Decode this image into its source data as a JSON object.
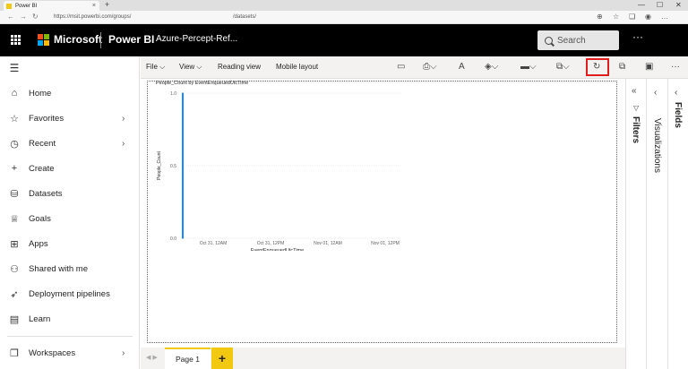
{
  "browser": {
    "tab_title": "Power BI",
    "tab_close": "×",
    "new_tab": "+",
    "url_left": "https://msit.powerbi.com/groups/",
    "url_right": "/datasets/",
    "win_min": "—",
    "win_max": "☐",
    "win_close": "✕"
  },
  "header": {
    "brand": "Microsoft",
    "product": "Power BI",
    "report_name": "Azure-Percept-Ref...",
    "search_placeholder": "Search",
    "more": "···"
  },
  "leftnav": {
    "items": [
      {
        "label": "Home",
        "icon": "home-icon",
        "glyph": "⌂",
        "chevron": ""
      },
      {
        "label": "Favorites",
        "icon": "star-icon",
        "glyph": "☆",
        "chevron": "›"
      },
      {
        "label": "Recent",
        "icon": "clock-icon",
        "glyph": "◷",
        "chevron": "›"
      },
      {
        "label": "Create",
        "icon": "plus-icon",
        "glyph": "+",
        "chevron": ""
      },
      {
        "label": "Datasets",
        "icon": "database-icon",
        "glyph": "⛁",
        "chevron": ""
      },
      {
        "label": "Goals",
        "icon": "trophy-icon",
        "glyph": "♕",
        "chevron": ""
      },
      {
        "label": "Apps",
        "icon": "apps-icon",
        "glyph": "⊞",
        "chevron": ""
      },
      {
        "label": "Shared with me",
        "icon": "shared-icon",
        "glyph": "⚇",
        "chevron": ""
      },
      {
        "label": "Deployment pipelines",
        "icon": "rocket-icon",
        "glyph": "➶",
        "chevron": ""
      },
      {
        "label": "Learn",
        "icon": "book-icon",
        "glyph": "▤",
        "chevron": ""
      },
      {
        "label": "Workspaces",
        "icon": "workspaces-icon",
        "glyph": "❐",
        "chevron": "›"
      }
    ]
  },
  "toolbar": {
    "file": "File ⌵",
    "view": "View ⌵",
    "reading_view": "Reading view",
    "mobile_layout": "Mobile layout",
    "more": "···"
  },
  "chart_data": {
    "type": "line",
    "title": "People_Count by EventEnqueuedUtcTime",
    "xlabel": "EventEnqueuedUtcTime",
    "ylabel": "People_Count",
    "x_ticks": [
      "Oct 31, 12AM",
      "Oct 31, 12PM",
      "Nov 01, 12AM",
      "Nov 01, 12PM"
    ],
    "y_ticks": [
      "1.0",
      "0.5",
      "0.0"
    ],
    "ylim": [
      0,
      1
    ],
    "grid": true,
    "series": [
      {
        "points": [
          {
            "x": "Oct 30, 6PM",
            "y": 0
          },
          {
            "x": "Oct 30, 6PM",
            "y": 1
          }
        ]
      }
    ],
    "line_color": "#118dff"
  },
  "pages": {
    "tabs": [
      "Page 1"
    ],
    "add_label": "+",
    "nav_prev": "◀",
    "nav_next": "▶"
  },
  "panes": {
    "filters": "Filters",
    "visualizations": "Visualizations",
    "fields": "Fields"
  },
  "colors": {
    "accent": "#f2c811",
    "highlight_box": "#e01e1e"
  }
}
